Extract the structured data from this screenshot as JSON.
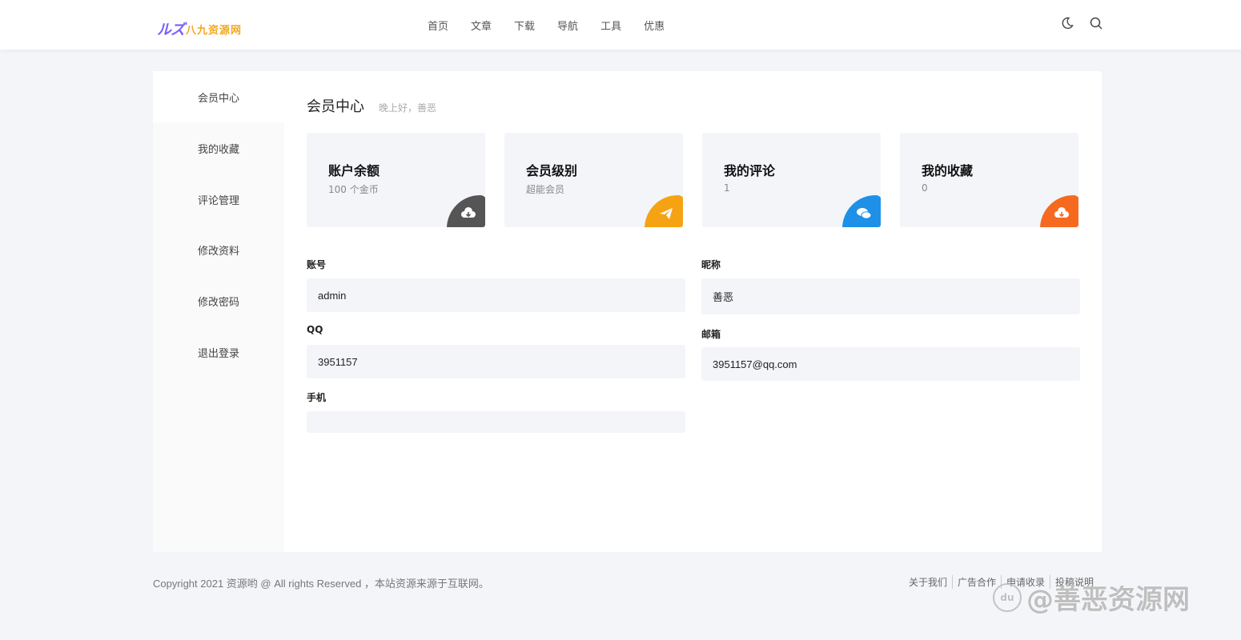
{
  "header": {
    "logo_mark": "ルズ",
    "logo_text": "八九资源网",
    "nav": [
      "首页",
      "文章",
      "下载",
      "导航",
      "工具",
      "优惠"
    ],
    "icons": [
      "moon-icon",
      "search-icon"
    ]
  },
  "sidebar": {
    "items": [
      {
        "label": "会员中心",
        "active": true
      },
      {
        "label": "我的收藏",
        "active": false
      },
      {
        "label": "评论管理",
        "active": false
      },
      {
        "label": "修改资料",
        "active": false
      },
      {
        "label": "修改密码",
        "active": false
      },
      {
        "label": "退出登录",
        "active": false
      }
    ]
  },
  "main": {
    "title": "会员中心",
    "greeting": "晚上好，善恶",
    "cards": [
      {
        "title": "账户余额",
        "value": "100 个金币",
        "icon": "cloud-download-icon",
        "color": "#555555"
      },
      {
        "title": "会员级别",
        "value": "超能会员",
        "icon": "paper-plane-icon",
        "color": "#f5a312"
      },
      {
        "title": "我的评论",
        "value": "1",
        "icon": "chat-bubbles-icon",
        "color": "#1e90e8"
      },
      {
        "title": "我的收藏",
        "value": "0",
        "icon": "cloud-download-icon",
        "color": "#f56a1f"
      }
    ],
    "fields": {
      "account": {
        "label": "账号",
        "value": "admin"
      },
      "nickname": {
        "label": "昵称",
        "value": "善恶"
      },
      "qq": {
        "label": "QQ",
        "value": "3951157"
      },
      "email": {
        "label": "邮箱",
        "value": "3951157@qq.com"
      },
      "phone": {
        "label": "手机",
        "value": ""
      }
    }
  },
  "footer": {
    "copyright": "Copyright 2021 资源哟 @ All rights Reserved ，本站资源来源于互联网。",
    "links": [
      "关于我们",
      "广告合作",
      "申请收录",
      "投稿说明"
    ]
  },
  "watermark": {
    "badge": "du",
    "text": "@善恶资源网"
  }
}
